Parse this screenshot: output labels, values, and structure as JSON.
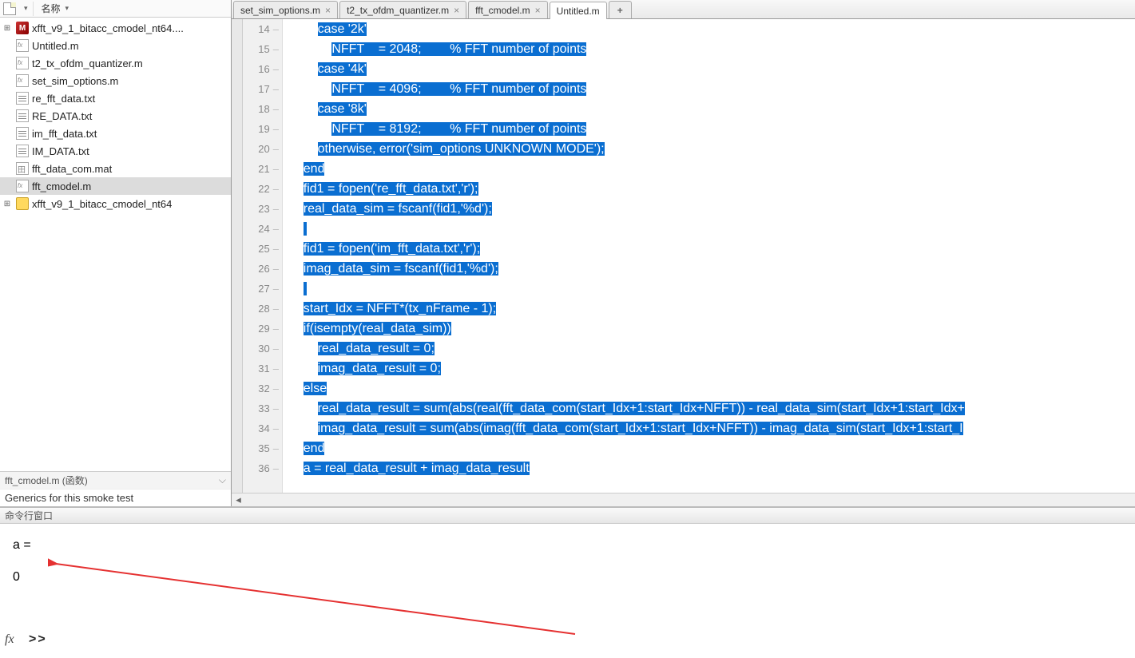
{
  "sidebar": {
    "colHeader": "名称",
    "entries": [
      {
        "label": "xfft_v9_1_bitacc_cmodel_nt64....",
        "icon": "model",
        "expander": "+",
        "interact": true
      },
      {
        "label": "Untitled.m",
        "icon": "mfile",
        "expander": "",
        "interact": true
      },
      {
        "label": "t2_tx_ofdm_quantizer.m",
        "icon": "mfile",
        "expander": "",
        "interact": true
      },
      {
        "label": "set_sim_options.m",
        "icon": "mfile",
        "expander": "",
        "interact": true
      },
      {
        "label": "re_fft_data.txt",
        "icon": "txt",
        "expander": "",
        "interact": true
      },
      {
        "label": "RE_DATA.txt",
        "icon": "txt",
        "expander": "",
        "interact": true
      },
      {
        "label": "im_fft_data.txt",
        "icon": "txt",
        "expander": "",
        "interact": true
      },
      {
        "label": "IM_DATA.txt",
        "icon": "txt",
        "expander": "",
        "interact": true
      },
      {
        "label": "fft_data_com.mat",
        "icon": "mat",
        "expander": "",
        "interact": true
      },
      {
        "label": "fft_cmodel.m",
        "icon": "mfile",
        "expander": "",
        "interact": true,
        "selected": true
      },
      {
        "label": "xfft_v9_1_bitacc_cmodel_nt64",
        "icon": "folder",
        "expander": "+",
        "interact": true
      }
    ],
    "bottomLabel": "fft_cmodel.m (函数)",
    "dummyRow": "Generics for this smoke test"
  },
  "tabs": [
    {
      "label": "set_sim_options.m",
      "active": false
    },
    {
      "label": "t2_tx_ofdm_quantizer.m",
      "active": false
    },
    {
      "label": "fft_cmodel.m",
      "active": false
    },
    {
      "label": "Untitled.m",
      "active": true
    }
  ],
  "code": {
    "startLine": 14,
    "lines": [
      {
        "indent": "        ",
        "text": "case '2k'"
      },
      {
        "indent": "            ",
        "text": "NFFT    = 2048;        % FFT number of points"
      },
      {
        "indent": "        ",
        "text": "case '4k'"
      },
      {
        "indent": "            ",
        "text": "NFFT    = 4096;        % FFT number of points"
      },
      {
        "indent": "        ",
        "text": "case '8k'"
      },
      {
        "indent": "            ",
        "text": "NFFT    = 8192;        % FFT number of points"
      },
      {
        "indent": "        ",
        "text": "otherwise, error('sim_options UNKNOWN MODE');"
      },
      {
        "indent": "    ",
        "text": "end"
      },
      {
        "indent": "    ",
        "text": "fid1 = fopen('re_fft_data.txt','r');"
      },
      {
        "indent": "    ",
        "text": "real_data_sim = fscanf(fid1,'%d');"
      },
      {
        "indent": "    ",
        "text": ""
      },
      {
        "indent": "    ",
        "text": "fid1 = fopen('im_fft_data.txt','r');"
      },
      {
        "indent": "    ",
        "text": "imag_data_sim = fscanf(fid1,'%d');"
      },
      {
        "indent": "    ",
        "text": ""
      },
      {
        "indent": "    ",
        "text": "start_Idx = NFFT*(tx_nFrame - 1);"
      },
      {
        "indent": "    ",
        "text": "if(isempty(real_data_sim))"
      },
      {
        "indent": "        ",
        "text": "real_data_result = 0;"
      },
      {
        "indent": "        ",
        "text": "imag_data_result = 0;"
      },
      {
        "indent": "    ",
        "text": "else"
      },
      {
        "indent": "        ",
        "text": "real_data_result = sum(abs(real(fft_data_com(start_Idx+1:start_Idx+NFFT)) - real_data_sim(start_Idx+1:start_Idx+"
      },
      {
        "indent": "        ",
        "text": "imag_data_result = sum(abs(imag(fft_data_com(start_Idx+1:start_Idx+NFFT)) - imag_data_sim(start_Idx+1:start_I"
      },
      {
        "indent": "    ",
        "text": "end"
      },
      {
        "indent": "    ",
        "text": "a = real_data_result + imag_data_result"
      }
    ]
  },
  "console": {
    "title": "命令行窗口",
    "out1": "a =",
    "out2": "     0",
    "prompt": ">>"
  }
}
